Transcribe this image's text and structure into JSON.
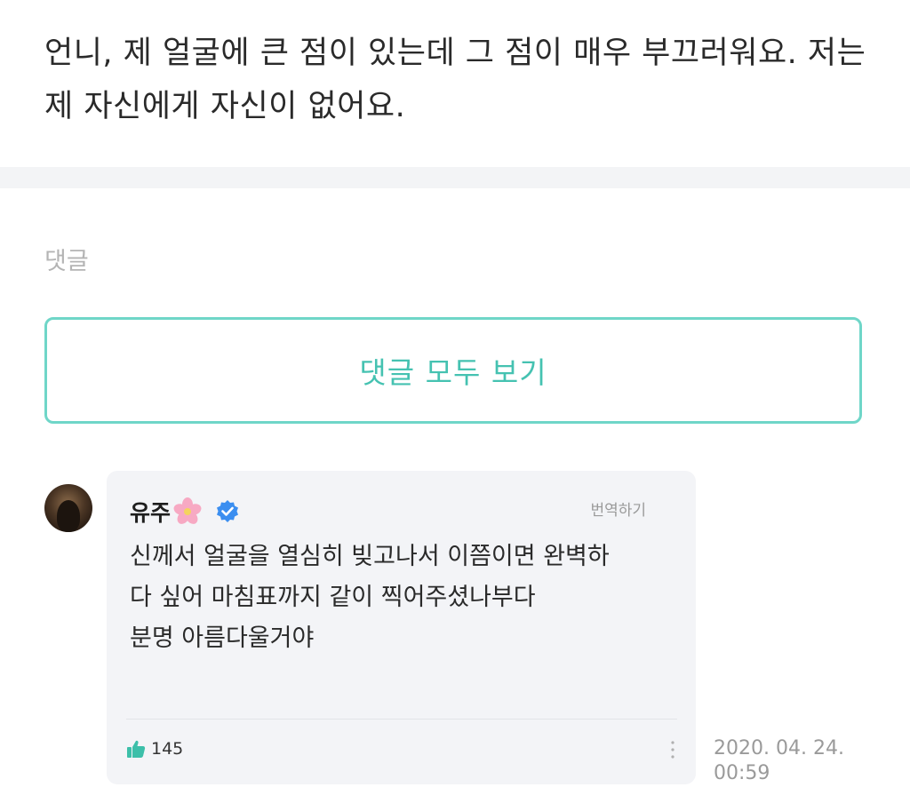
{
  "post": {
    "body": "언니, 제 얼굴에 큰 점이 있는데 그 점이 매우 부끄러워요. 저는 제 자신에게 자신이 없어요."
  },
  "comments_section": {
    "title": "댓글",
    "view_all_label": "댓글 모두 보기",
    "accent_color": "#45c2b1"
  },
  "comment": {
    "author": "유주",
    "author_emoji_icon": "cherry-blossom-icon",
    "verified_icon": "verified-badge-icon",
    "translate_label": "번역하기",
    "lines": [
      "신께서 얼굴을 열심히 빚고나서 이쯤이면 완벽하",
      "다 싶어 마침표까지 같이 찍어주셨나부다",
      "분명 아름다울거야"
    ],
    "like_icon": "thumbs-up-icon",
    "likes": "145",
    "more_icon": "more-vertical-icon",
    "date": "2020. 04. 24.",
    "time": "00:59"
  }
}
